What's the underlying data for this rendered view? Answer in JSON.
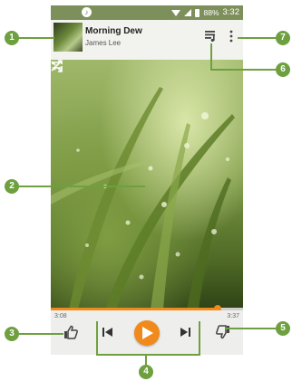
{
  "status_bar": {
    "battery": "88%",
    "time": "3:32"
  },
  "now_playing": {
    "title": "Morning Dew",
    "artist": "James Lee"
  },
  "player": {
    "elapsed": "3:08",
    "total": "3:37",
    "progress": 0.87
  },
  "callouts": [
    "1",
    "2",
    "3",
    "4",
    "5",
    "6",
    "7"
  ],
  "colors": {
    "accent": "#f08a1c",
    "callout": "#6fa040"
  },
  "icons": [
    "queue-icon",
    "more-icon",
    "repeat-icon",
    "shuffle-icon",
    "thumbs-up-icon",
    "previous-icon",
    "play-icon",
    "next-icon",
    "thumbs-down-icon"
  ]
}
